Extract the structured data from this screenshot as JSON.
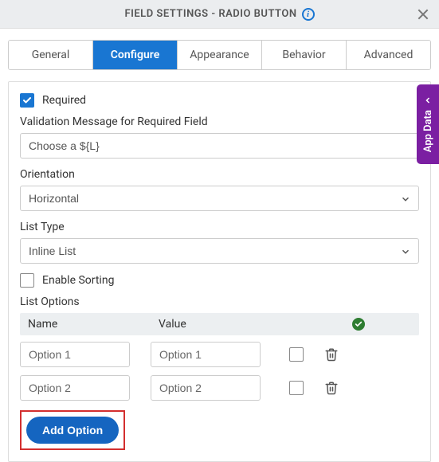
{
  "header": {
    "title": "FIELD SETTINGS - RADIO BUTTON"
  },
  "tabs": {
    "general": "General",
    "configure": "Configure",
    "appearance": "Appearance",
    "behavior": "Behavior",
    "advanced": "Advanced"
  },
  "form": {
    "required_label": "Required",
    "required_checked": true,
    "validation_label": "Validation Message for Required Field",
    "validation_value": "Choose a ${L}",
    "orientation_label": "Orientation",
    "orientation_value": "Horizontal",
    "listtype_label": "List Type",
    "listtype_value": "Inline List",
    "enable_sorting_label": "Enable Sorting",
    "enable_sorting_checked": false,
    "list_options_label": "List Options",
    "columns": {
      "name": "Name",
      "value": "Value"
    },
    "options": [
      {
        "name": "Option 1",
        "value": "Option 1"
      },
      {
        "name": "Option 2",
        "value": "Option 2"
      }
    ],
    "add_option_label": "Add Option"
  },
  "sidetab": {
    "label": "App Data"
  }
}
